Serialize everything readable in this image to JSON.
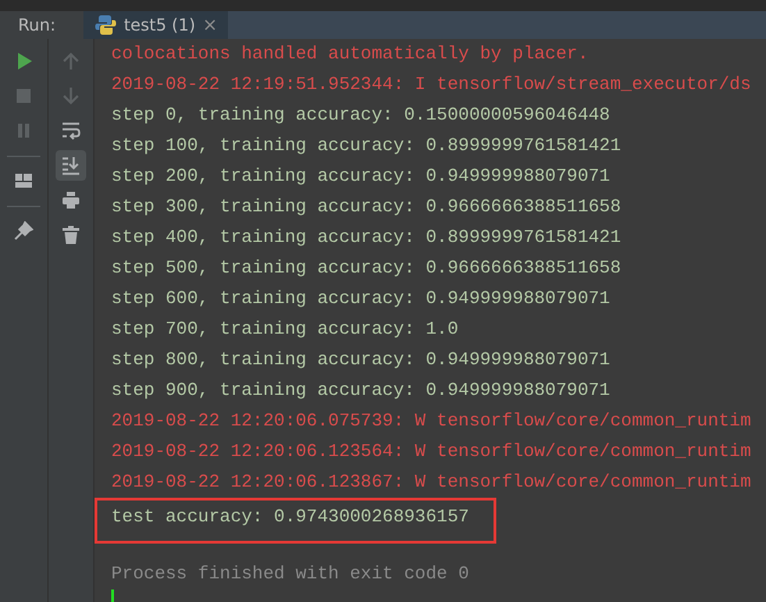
{
  "tool_window": {
    "label": "Run:",
    "tabs": [
      {
        "label": "test5 (1)",
        "close": "×",
        "selected": true
      }
    ]
  },
  "left_toolbar": [
    {
      "kind": "run",
      "disabled": false
    },
    {
      "kind": "stop",
      "disabled": true
    },
    {
      "kind": "pause",
      "disabled": true
    },
    {
      "kind": "layout",
      "disabled": false
    },
    {
      "kind": "pin",
      "disabled": false
    }
  ],
  "side_toolbar": [
    {
      "kind": "up",
      "disabled": true,
      "selected": false
    },
    {
      "kind": "down",
      "disabled": true,
      "selected": false
    },
    {
      "kind": "wrap",
      "disabled": false,
      "selected": false
    },
    {
      "kind": "scroll-end",
      "disabled": false,
      "selected": true
    },
    {
      "kind": "print",
      "disabled": false,
      "selected": false
    },
    {
      "kind": "trash",
      "disabled": false,
      "selected": false
    }
  ],
  "console": {
    "cursor": true,
    "lines": [
      {
        "kind": "stderr",
        "text": "colocations handled automatically by placer.",
        "highlighted": false
      },
      {
        "kind": "stderr",
        "text": "2019-08-22 12:19:51.952344: I tensorflow/stream_executor/ds",
        "highlighted": false
      },
      {
        "kind": "stdout",
        "text": "step 0, training accuracy: 0.15000000596046448",
        "highlighted": false
      },
      {
        "kind": "stdout",
        "text": "step 100, training accuracy: 0.8999999761581421",
        "highlighted": false
      },
      {
        "kind": "stdout",
        "text": "step 200, training accuracy: 0.949999988079071",
        "highlighted": false
      },
      {
        "kind": "stdout",
        "text": "step 300, training accuracy: 0.9666666388511658",
        "highlighted": false
      },
      {
        "kind": "stdout",
        "text": "step 400, training accuracy: 0.8999999761581421",
        "highlighted": false
      },
      {
        "kind": "stdout",
        "text": "step 500, training accuracy: 0.9666666388511658",
        "highlighted": false
      },
      {
        "kind": "stdout",
        "text": "step 600, training accuracy: 0.949999988079071",
        "highlighted": false
      },
      {
        "kind": "stdout",
        "text": "step 700, training accuracy: 1.0",
        "highlighted": false
      },
      {
        "kind": "stdout",
        "text": "step 800, training accuracy: 0.949999988079071",
        "highlighted": false
      },
      {
        "kind": "stdout",
        "text": "step 900, training accuracy: 0.949999988079071",
        "highlighted": false
      },
      {
        "kind": "stderr",
        "text": "2019-08-22 12:20:06.075739: W tensorflow/core/common_runtim",
        "highlighted": false
      },
      {
        "kind": "stderr",
        "text": "2019-08-22 12:20:06.123564: W tensorflow/core/common_runtim",
        "highlighted": false
      },
      {
        "kind": "stderr",
        "text": "2019-08-22 12:20:06.123867: W tensorflow/core/common_runtim",
        "highlighted": false
      },
      {
        "kind": "stdout",
        "text": "test accuracy: 0.9743000268936157",
        "highlighted": true
      },
      {
        "kind": "system",
        "text": "Process finished with exit code 0",
        "highlighted": false
      }
    ]
  }
}
